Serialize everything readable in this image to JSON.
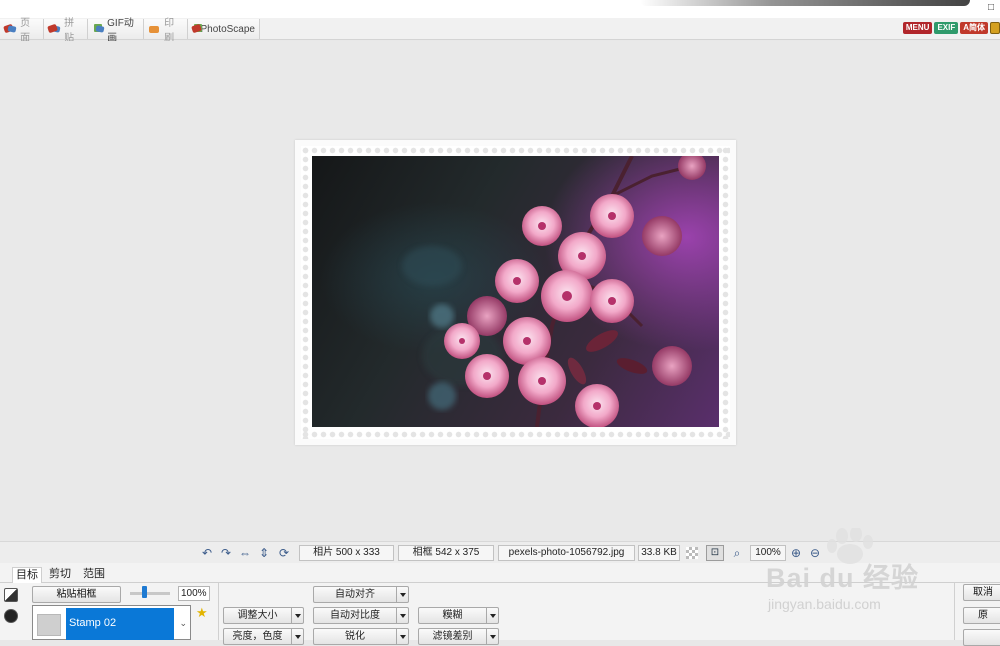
{
  "window": {
    "corner_button": "□"
  },
  "tabs": [
    {
      "label": "页面",
      "icon": "page-icon",
      "active": false
    },
    {
      "label": "拼贴",
      "icon": "combine-icon",
      "active": false
    },
    {
      "label": "GIF动画",
      "icon": "gif-icon",
      "active": true
    },
    {
      "label": "印刷",
      "icon": "print-icon",
      "active": false
    },
    {
      "label": "PhotoScape",
      "icon": "photoscape-icon",
      "active": true
    }
  ],
  "badges": {
    "menu": "MENU",
    "exif": "EXIF",
    "lang": "A简体"
  },
  "status": {
    "photo_size": "相片 500 x 333",
    "frame_size": "相框 542 x 375",
    "file_name": "pexels-photo-1056792.jpg",
    "file_size": "33.8 KB",
    "zoom": "100%"
  },
  "panel": {
    "tabs": {
      "target": "目标",
      "crop": "剪切",
      "range": "范围"
    },
    "paste_frame": "粘贴相框",
    "opacity": "100%",
    "opacity_value": 1.0,
    "frame_name": "Stamp 02",
    "buttons": {
      "resize": "调整大小",
      "brightness": "亮度，色度",
      "auto_level": "自动对齐",
      "auto_contrast": "自动对比度",
      "sharpen": "锐化",
      "blur": "糢糊",
      "filter": "滤镜差别",
      "cancel": "取消",
      "original": "原"
    }
  },
  "watermark": {
    "text": "Bai du 经验",
    "url": "jingyan.baidu.com"
  },
  "colors": {
    "selection": "#0a78d7",
    "star": "#e2b400",
    "menu_badge": "#b1262b",
    "exif_badge": "#2f9a6b"
  }
}
